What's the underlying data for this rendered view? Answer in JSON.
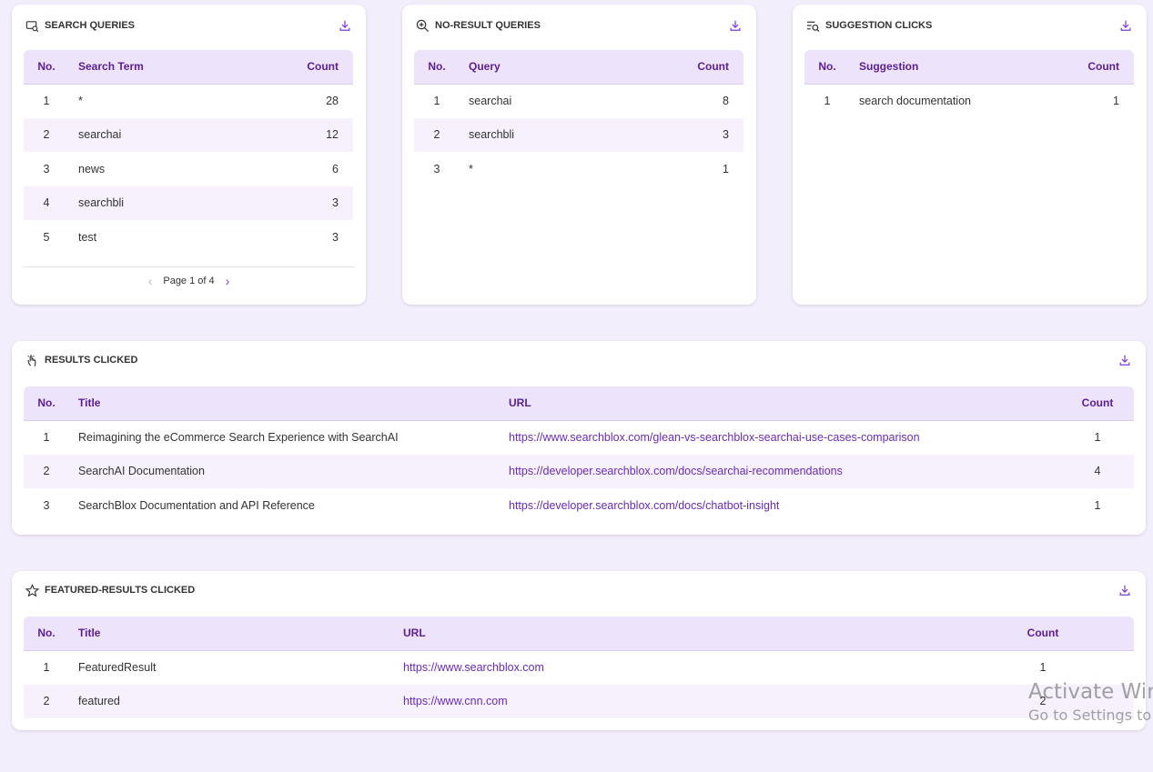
{
  "search_queries": {
    "title": "SEARCH QUERIES",
    "columns": [
      "No.",
      "Search Term",
      "Count"
    ],
    "rows": [
      {
        "no": "1",
        "term": "*",
        "count": "28"
      },
      {
        "no": "2",
        "term": "searchai",
        "count": "12"
      },
      {
        "no": "3",
        "term": "news",
        "count": "6"
      },
      {
        "no": "4",
        "term": "searchbli",
        "count": "3"
      },
      {
        "no": "5",
        "term": "test",
        "count": "3"
      }
    ],
    "pagination": {
      "label": "Page 1 of 4",
      "prev_icon": "‹",
      "next_icon": "›"
    }
  },
  "no_result_queries": {
    "title": "NO-RESULT QUERIES",
    "columns": [
      "No.",
      "Query",
      "Count"
    ],
    "rows": [
      {
        "no": "1",
        "term": "searchai",
        "count": "8"
      },
      {
        "no": "2",
        "term": "searchbli",
        "count": "3"
      },
      {
        "no": "3",
        "term": "*",
        "count": "1"
      }
    ]
  },
  "suggestion_clicks": {
    "title": "SUGGESTION CLICKS",
    "columns": [
      "No.",
      "Suggestion",
      "Count"
    ],
    "rows": [
      {
        "no": "1",
        "term": "search documentation",
        "count": "1"
      }
    ]
  },
  "results_clicked": {
    "title": "RESULTS CLICKED",
    "columns": [
      "No.",
      "Title",
      "URL",
      "Count"
    ],
    "rows": [
      {
        "no": "1",
        "title": "Reimagining the eCommerce Search Experience with SearchAI",
        "url": "https://www.searchblox.com/glean-vs-searchblox-searchai-use-cases-comparison",
        "count": "1"
      },
      {
        "no": "2",
        "title": "SearchAI Documentation",
        "url": "https://developer.searchblox.com/docs/searchai-recommendations",
        "count": "4"
      },
      {
        "no": "3",
        "title": "SearchBlox Documentation and API Reference",
        "url": "https://developer.searchblox.com/docs/chatbot-insight",
        "count": "1"
      }
    ]
  },
  "featured_results_clicked": {
    "title": "FEATURED-RESULTS CLICKED",
    "columns": [
      "No.",
      "Title",
      "URL",
      "Count"
    ],
    "rows": [
      {
        "no": "1",
        "title": "FeaturedResult",
        "url": "https://www.searchblox.com",
        "count": "1"
      },
      {
        "no": "2",
        "title": "featured",
        "url": "https://www.cnn.com",
        "count": "2"
      }
    ]
  },
  "watermark": {
    "line1": "Activate Win",
    "line2": "Go to Settings to"
  },
  "colors": {
    "accent": "#7b3bd0",
    "header_bg": "#ede3fb",
    "page_bg": "#f3eefc",
    "link": "#6a2bb8"
  },
  "icons": {
    "download": "download-icon",
    "search_queries": "search-queries-icon",
    "no_result": "zoom-search-icon",
    "suggestion": "list-search-icon",
    "results_clicked": "hand-click-icon",
    "featured": "star-icon"
  }
}
